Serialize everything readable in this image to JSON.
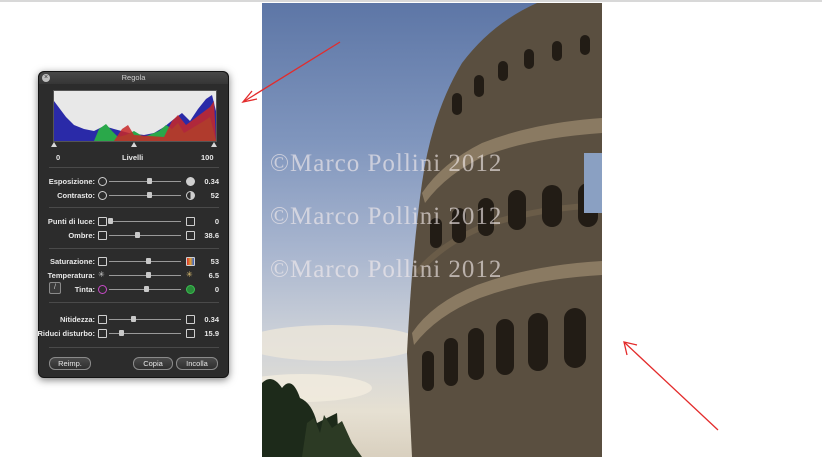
{
  "panel": {
    "title": "Regola",
    "levels": {
      "label": "Livelli",
      "min": "0",
      "max": "100"
    },
    "rows": [
      {
        "label": "Esposizione:",
        "value": "0.34"
      },
      {
        "label": "Contrasto:",
        "value": "52"
      },
      {
        "label": "Punti di luce:",
        "value": "0"
      },
      {
        "label": "Ombre:",
        "value": "38.6"
      },
      {
        "label": "Saturazione:",
        "value": "53"
      },
      {
        "label": "Temperatura:",
        "value": "6.5"
      },
      {
        "label": "Tinta:",
        "value": "0"
      },
      {
        "label": "Nitidezza:",
        "value": "0.34"
      },
      {
        "label": "Riduci disturbo:",
        "value": "15.9"
      }
    ],
    "buttons": {
      "reset": "Reimp.",
      "copy": "Copia",
      "paste": "Incolla"
    }
  },
  "photo": {
    "watermark": "©Marco Pollini 2012"
  },
  "colors": {
    "arrow": "#e32b2b",
    "panel": "#2c2c2c"
  }
}
